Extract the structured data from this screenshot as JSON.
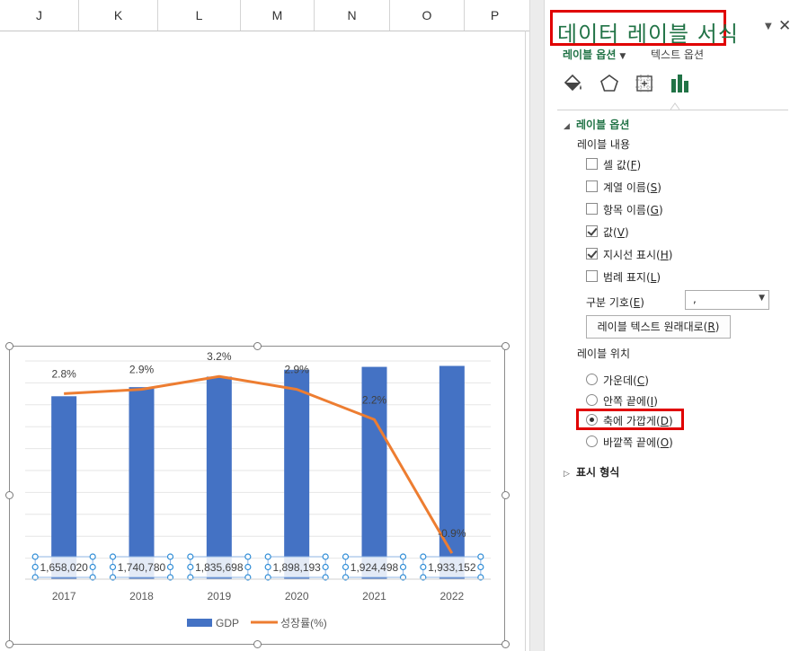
{
  "columns": [
    "J",
    "K",
    "L",
    "M",
    "N",
    "O",
    "P"
  ],
  "pane": {
    "title": "데이터 레이블 서식",
    "tabs": {
      "label_options": "레이블 옵션",
      "text_options": "텍스트 옵션"
    },
    "icons": [
      "fill-line-icon",
      "effects-pentagon-icon",
      "size-properties-icon",
      "bar-chart-icon"
    ],
    "section_label_options": "레이블 옵션",
    "label_contains": "레이블 내용",
    "checkboxes": [
      {
        "label": "셀 값",
        "key": "F",
        "checked": false
      },
      {
        "label": "계열 이름",
        "key": "S",
        "checked": false
      },
      {
        "label": "항목 이름",
        "key": "G",
        "checked": false
      },
      {
        "label": "값",
        "key": "V",
        "checked": true
      },
      {
        "label": "지시선 표시",
        "key": "H",
        "checked": true
      },
      {
        "label": "범례 표지",
        "key": "L",
        "checked": false
      }
    ],
    "separator": {
      "label": "구분 기호",
      "key": "E",
      "value": ","
    },
    "reset_button": {
      "label": "레이블 텍스트 원래대로",
      "key": "R"
    },
    "label_position": "레이블 위치",
    "positions": [
      {
        "label": "가운데",
        "key": "C",
        "selected": false
      },
      {
        "label": "안쪽 끝에",
        "key": "I",
        "selected": false
      },
      {
        "label": "축에 가깝게",
        "key": "D",
        "selected": true
      },
      {
        "label": "바깥쪽 끝에",
        "key": "O",
        "selected": false
      }
    ],
    "section_number": "표시 형식"
  },
  "chart_data": {
    "type": "bar",
    "categories": [
      "2017",
      "2018",
      "2019",
      "2020",
      "2021",
      "2022"
    ],
    "series": [
      {
        "name": "GDP",
        "type": "bar",
        "color": "#4472c4",
        "values": [
          1658020,
          1740780,
          1835698,
          1898193,
          1924498,
          1933152
        ],
        "labels": [
          "1,658,020",
          "1,740,780",
          "1,835,698",
          "1,898,193",
          "1,924,498",
          "1,933,152"
        ]
      },
      {
        "name": "성장률(%)",
        "type": "line",
        "color": "#ed7d31",
        "values": [
          2.8,
          2.9,
          3.2,
          2.9,
          2.2,
          -0.9
        ],
        "labels": [
          "2.8%",
          "2.9%",
          "3.2%",
          "2.9%",
          "2.2%",
          "-0.9%"
        ]
      }
    ],
    "legend": "bottom",
    "grid": true
  }
}
